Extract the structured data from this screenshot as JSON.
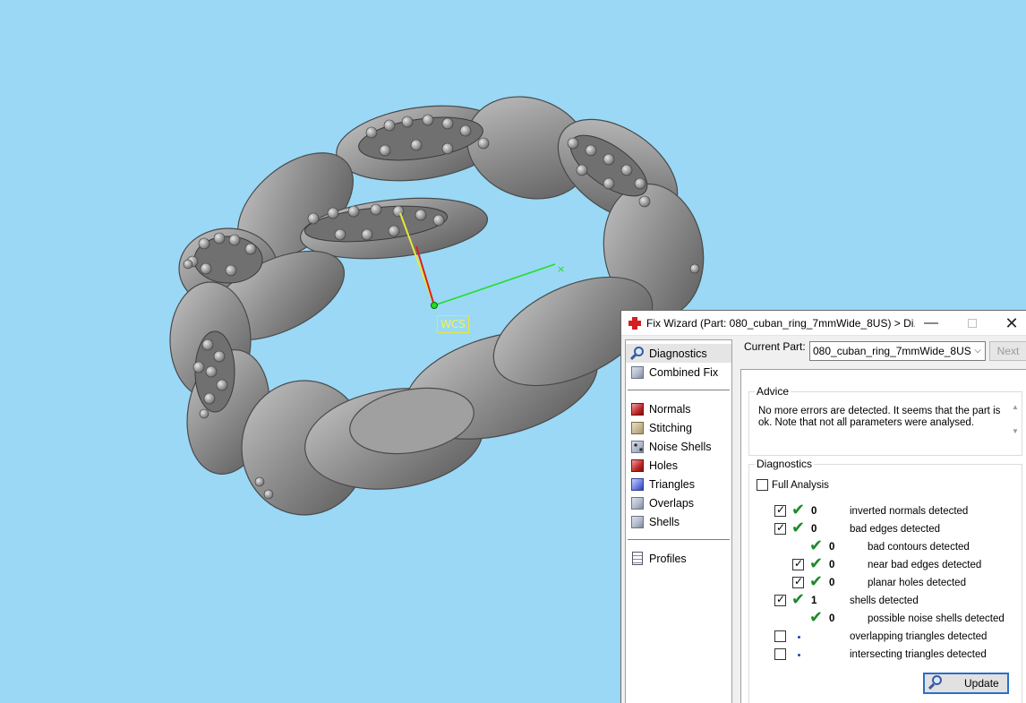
{
  "viewport": {
    "axis_label": "WCS",
    "colors": {
      "background": "#9ad8f5",
      "model": "#8d8d8d",
      "y_axis": "#e8e838",
      "z_axis": "#d82020",
      "x_axis": "#22dd22"
    }
  },
  "window": {
    "title": "Fix Wizard (Part: 080_cuban_ring_7mmWide_8US) > Di...",
    "min_glyph": "—",
    "close_glyph": "✕"
  },
  "nav": {
    "top": [
      {
        "label": "Diagnostics",
        "icon": "magnifier-icon",
        "selected": true
      },
      {
        "label": "Combined Fix",
        "icon": "cube-icon"
      }
    ],
    "fixes": [
      {
        "label": "Normals",
        "icon": "normals-icon"
      },
      {
        "label": "Stitching",
        "icon": "stitching-icon"
      },
      {
        "label": "Noise Shells",
        "icon": "noise-shells-icon"
      },
      {
        "label": "Holes",
        "icon": "holes-icon"
      },
      {
        "label": "Triangles",
        "icon": "triangles-icon"
      },
      {
        "label": "Overlaps",
        "icon": "overlaps-icon"
      },
      {
        "label": "Shells",
        "icon": "shells-icon"
      }
    ],
    "bottom": [
      {
        "label": "Profiles",
        "icon": "profiles-icon"
      }
    ]
  },
  "current_part": {
    "label": "Current Part:",
    "value": "080_cuban_ring_7mmWide_8US",
    "next_label": "Next"
  },
  "advice": {
    "heading": "Advice",
    "text": "No more errors are detected. It seems that the part is ok. Note that not all parameters were analysed."
  },
  "diagnostics": {
    "heading": "Diagnostics",
    "full_analysis_label": "Full Analysis",
    "full_analysis_checked": false,
    "rows": [
      {
        "checkbox": true,
        "checked": true,
        "status": "ok",
        "count": "0",
        "label": "inverted normals detected",
        "indent": 0
      },
      {
        "checkbox": true,
        "checked": true,
        "status": "ok",
        "count": "0",
        "label": "bad edges detected",
        "indent": 0
      },
      {
        "checkbox": false,
        "checked": false,
        "status": "ok",
        "count": "0",
        "label": "bad contours detected",
        "indent": 1
      },
      {
        "checkbox": true,
        "checked": true,
        "status": "ok",
        "count": "0",
        "label": "near bad edges detected",
        "indent": 1
      },
      {
        "checkbox": true,
        "checked": true,
        "status": "ok",
        "count": "0",
        "label": "planar holes detected",
        "indent": 1
      },
      {
        "checkbox": true,
        "checked": true,
        "status": "ok",
        "count": "1",
        "label": "shells detected",
        "indent": 0
      },
      {
        "checkbox": false,
        "checked": false,
        "status": "ok",
        "count": "0",
        "label": "possible noise shells detected",
        "indent": 1
      },
      {
        "checkbox": true,
        "checked": false,
        "status": "pending",
        "count": "",
        "label": "overlapping triangles detected",
        "indent": 0
      },
      {
        "checkbox": true,
        "checked": false,
        "status": "pending",
        "count": "",
        "label": "intersecting triangles detected",
        "indent": 0
      }
    ],
    "update_label": "Update"
  }
}
